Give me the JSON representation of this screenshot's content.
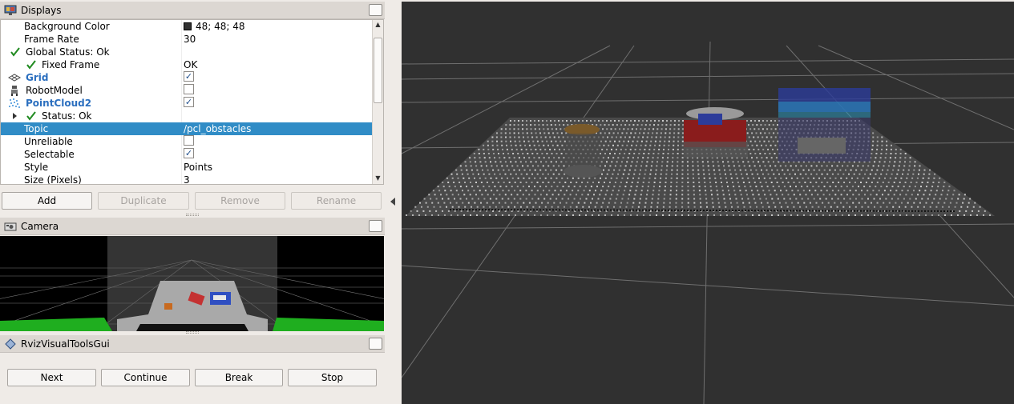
{
  "displays": {
    "title": "Displays",
    "rows": [
      {
        "label": "Background Color",
        "value": "48; 48; 48"
      },
      {
        "label": "Frame Rate",
        "value": "30"
      },
      {
        "label": "Global Status: Ok",
        "value": ""
      },
      {
        "label": "Fixed Frame",
        "value": "OK"
      },
      {
        "label": "Grid",
        "value": ""
      },
      {
        "label": "RobotModel",
        "value": ""
      },
      {
        "label": "PointCloud2",
        "value": ""
      },
      {
        "label": "Status: Ok",
        "value": ""
      },
      {
        "label": "Topic",
        "value": "/pcl_obstacles"
      },
      {
        "label": "Unreliable",
        "value": ""
      },
      {
        "label": "Selectable",
        "value": ""
      },
      {
        "label": "Style",
        "value": "Points"
      },
      {
        "label": "Size (Pixels)",
        "value": "3"
      }
    ],
    "checkbox_states": {
      "grid": true,
      "robot_model": false,
      "pointcloud2": true,
      "unreliable": false,
      "selectable": true
    },
    "buttons": {
      "add": "Add",
      "duplicate": "Duplicate",
      "remove": "Remove",
      "rename": "Rename"
    }
  },
  "camera": {
    "title": "Camera"
  },
  "rviz_tools": {
    "title": "RvizVisualToolsGui",
    "buttons": {
      "next": "Next",
      "continue": "Continue",
      "break": "Break",
      "stop": "Stop"
    }
  },
  "colors": {
    "viewport_background": "#303030",
    "selection": "#308cc6",
    "enabled_display": "#2b6fbf",
    "status_ok": "#1f8a1f"
  },
  "icons": {
    "displays": "monitor-icon",
    "grid": "grid-icon",
    "robot_model": "robot-icon",
    "pointcloud2": "pointcloud-icon",
    "status_ok": "checkmark-icon",
    "camera": "camera-icon",
    "rviz_tools": "diamond-icon"
  }
}
